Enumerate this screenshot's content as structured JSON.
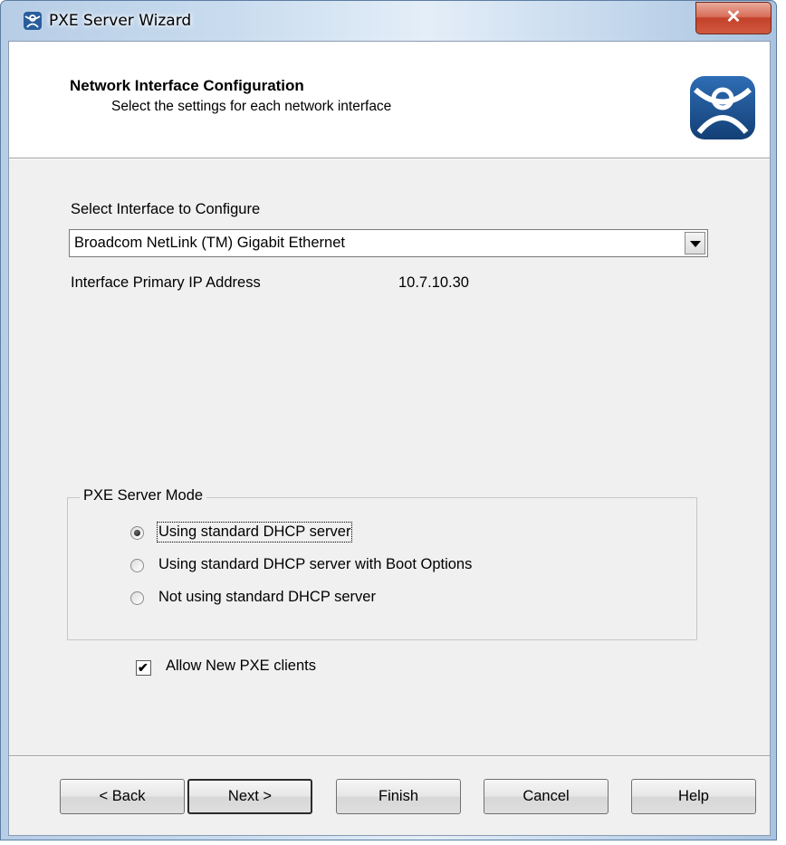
{
  "window": {
    "title": "PXE Server Wizard",
    "close_glyph": "✕"
  },
  "header": {
    "title": "Network Interface Configuration",
    "subtitle": "Select the settings for each network interface",
    "logo_icon": "thinmanager-logo-icon"
  },
  "interface": {
    "select_label": "Select Interface to Configure",
    "selected_value": "Broadcom NetLink (TM) Gigabit Ethernet",
    "ip_label": "Interface Primary IP Address",
    "ip_value": "10.7.10.30"
  },
  "pxe_mode": {
    "legend": "PXE Server Mode",
    "options": [
      {
        "label": "Using standard DHCP server",
        "checked": true
      },
      {
        "label": "Using standard DHCP server with Boot Options",
        "checked": false
      },
      {
        "label": "Not using standard DHCP server",
        "checked": false
      }
    ]
  },
  "allow_clients": {
    "label": "Allow New PXE clients",
    "checked": true,
    "check_glyph": "✔"
  },
  "buttons": {
    "back": "< Back",
    "next": "Next >",
    "finish": "Finish",
    "cancel": "Cancel",
    "help": "Help"
  },
  "colors": {
    "accent_blue": "#1b4f8c",
    "close_red": "#c4412a"
  }
}
